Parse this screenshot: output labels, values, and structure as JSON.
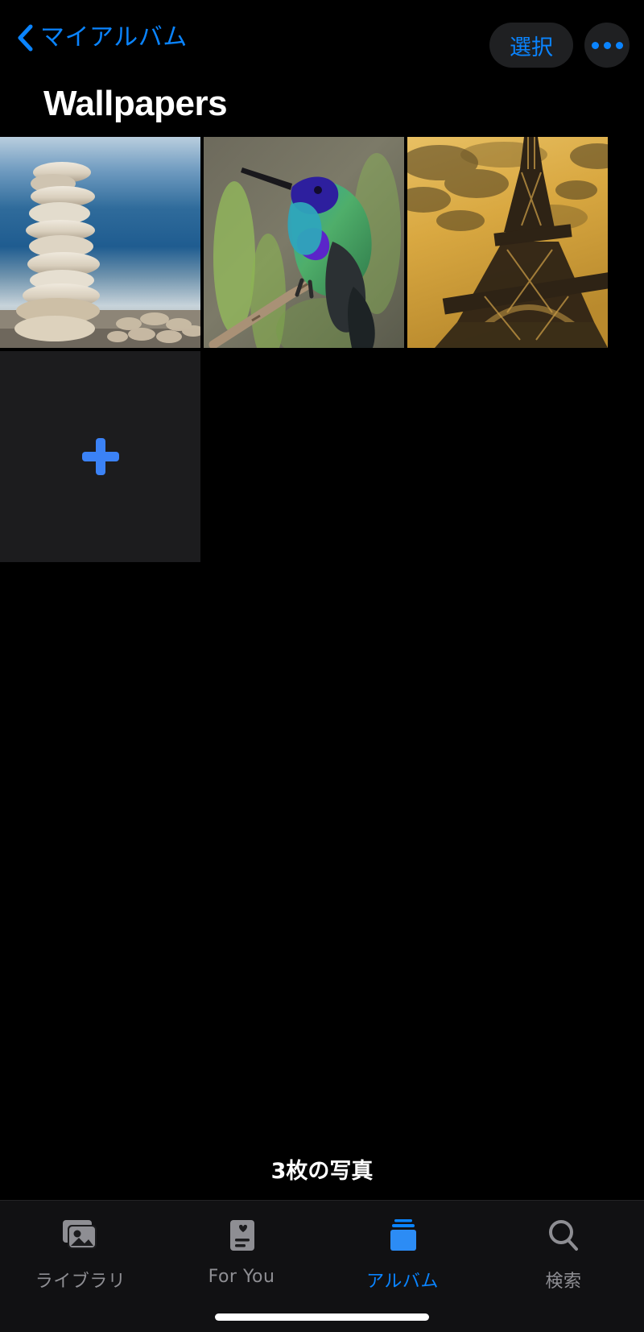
{
  "navbar": {
    "back_label": "マイアルバム",
    "back_icon": "chevron-left-icon",
    "select_label": "選択",
    "more_icon": "ellipsis-icon"
  },
  "header": {
    "title": "Wallpapers"
  },
  "grid": {
    "photos": [
      {
        "alt": "stacked zen stones on a beach with blue ocean behind"
      },
      {
        "alt": "iridescent green and purple hummingbird perched on a branch"
      },
      {
        "alt": "Eiffel Tower from below in sepia golden tones"
      }
    ],
    "add_tile": {
      "icon": "plus-icon",
      "accent": "#3b82f6"
    }
  },
  "footer": {
    "photo_count": "3枚の写真"
  },
  "tabbar": {
    "active_color": "#0A84FF",
    "inactive_color": "#8e8e93",
    "items": [
      {
        "label": "ライブラリ",
        "icon": "photo-stack-icon",
        "active": false
      },
      {
        "label": "For You",
        "icon": "for-you-card-icon",
        "active": false
      },
      {
        "label": "アルバム",
        "icon": "albums-stack-icon",
        "active": true
      },
      {
        "label": "検索",
        "icon": "search-icon",
        "active": false
      }
    ]
  }
}
